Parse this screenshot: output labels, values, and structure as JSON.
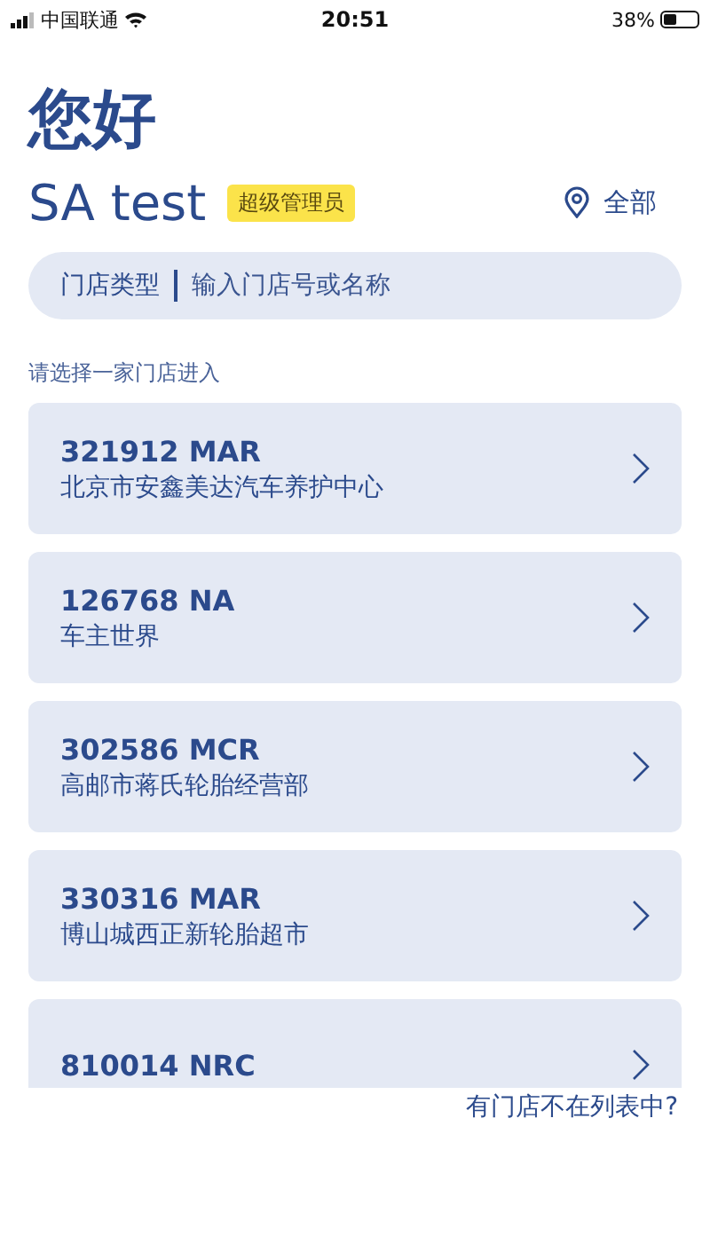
{
  "status_bar": {
    "carrier": "中国联通",
    "time": "20:51",
    "battery": "38%"
  },
  "greeting": "您好",
  "user": {
    "name": "SA test",
    "role_badge": "超级管理员"
  },
  "location": {
    "label": "全部"
  },
  "search": {
    "filter_label": "门店类型",
    "placeholder": "输入门店号或名称"
  },
  "list_hint": "请选择一家门店进入",
  "stores": [
    {
      "code": "321912 MAR",
      "name": "北京市安鑫美达汽车养护中心"
    },
    {
      "code": "126768 NA",
      "name": "车主世界"
    },
    {
      "code": "302586 MCR",
      "name": "高邮市蒋氏轮胎经营部"
    },
    {
      "code": "330316 MAR",
      "name": "博山城西正新轮胎超市"
    },
    {
      "code": "810014 NRC"
    }
  ],
  "missing_store_link": "有门店不在列表中?"
}
